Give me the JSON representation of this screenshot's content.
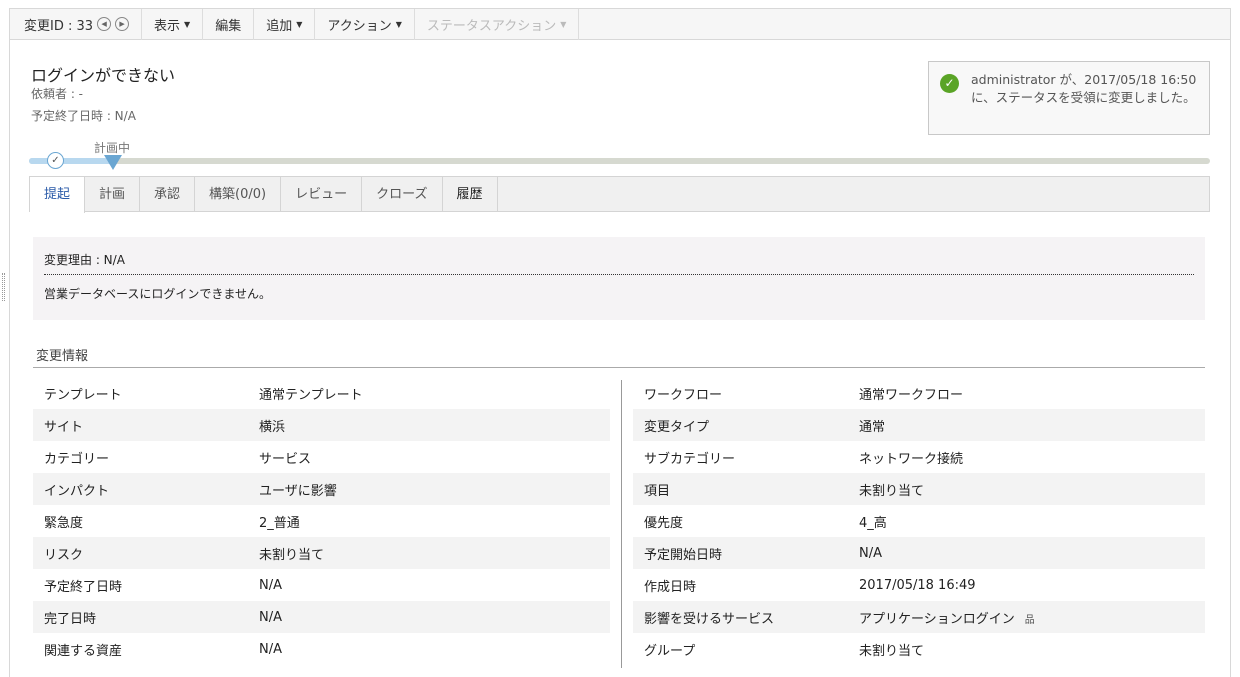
{
  "toolbar": {
    "change_id": "変更ID : 33",
    "view": "表示",
    "edit": "編集",
    "add": "追加",
    "action": "アクション",
    "status_action": "ステータスアクション"
  },
  "header": {
    "title": "ログインができない",
    "requester": "依頼者 : -",
    "due": "予定終了日時 : N/A"
  },
  "notice": {
    "text": "administrator が、2017/05/18 16:50 に、ステータスを受領に変更しました。"
  },
  "progress": {
    "current_stage": "計画中"
  },
  "tabs": [
    "提起",
    "計画",
    "承認",
    "構築(0/0)",
    "レビュー",
    "クローズ",
    "履歴"
  ],
  "reason": {
    "heading": "変更理由 : N/A",
    "body": "営業データベースにログインできません。"
  },
  "section": {
    "title": "変更情報"
  },
  "left": [
    [
      "テンプレート",
      "通常テンプレート"
    ],
    [
      "サイト",
      "横浜"
    ],
    [
      "カテゴリー",
      "サービス"
    ],
    [
      "インパクト",
      "ユーザに影響"
    ],
    [
      "緊急度",
      "2_普通"
    ],
    [
      "リスク",
      "未割り当て"
    ],
    [
      "予定終了日時",
      "N/A"
    ],
    [
      "完了日時",
      "N/A"
    ],
    [
      "関連する資産",
      "N/A"
    ]
  ],
  "right": [
    [
      "ワークフロー",
      "通常ワークフロー"
    ],
    [
      "変更タイプ",
      "通常"
    ],
    [
      "サブカテゴリー",
      "ネットワーク接続"
    ],
    [
      "項目",
      "未割り当て"
    ],
    [
      "優先度",
      "4_高"
    ],
    [
      "予定開始日時",
      "N/A"
    ],
    [
      "作成日時",
      "2017/05/18 16:49"
    ],
    [
      "影響を受けるサービス",
      "アプリケーションログイン"
    ],
    [
      "グループ",
      "未割り当て"
    ]
  ]
}
